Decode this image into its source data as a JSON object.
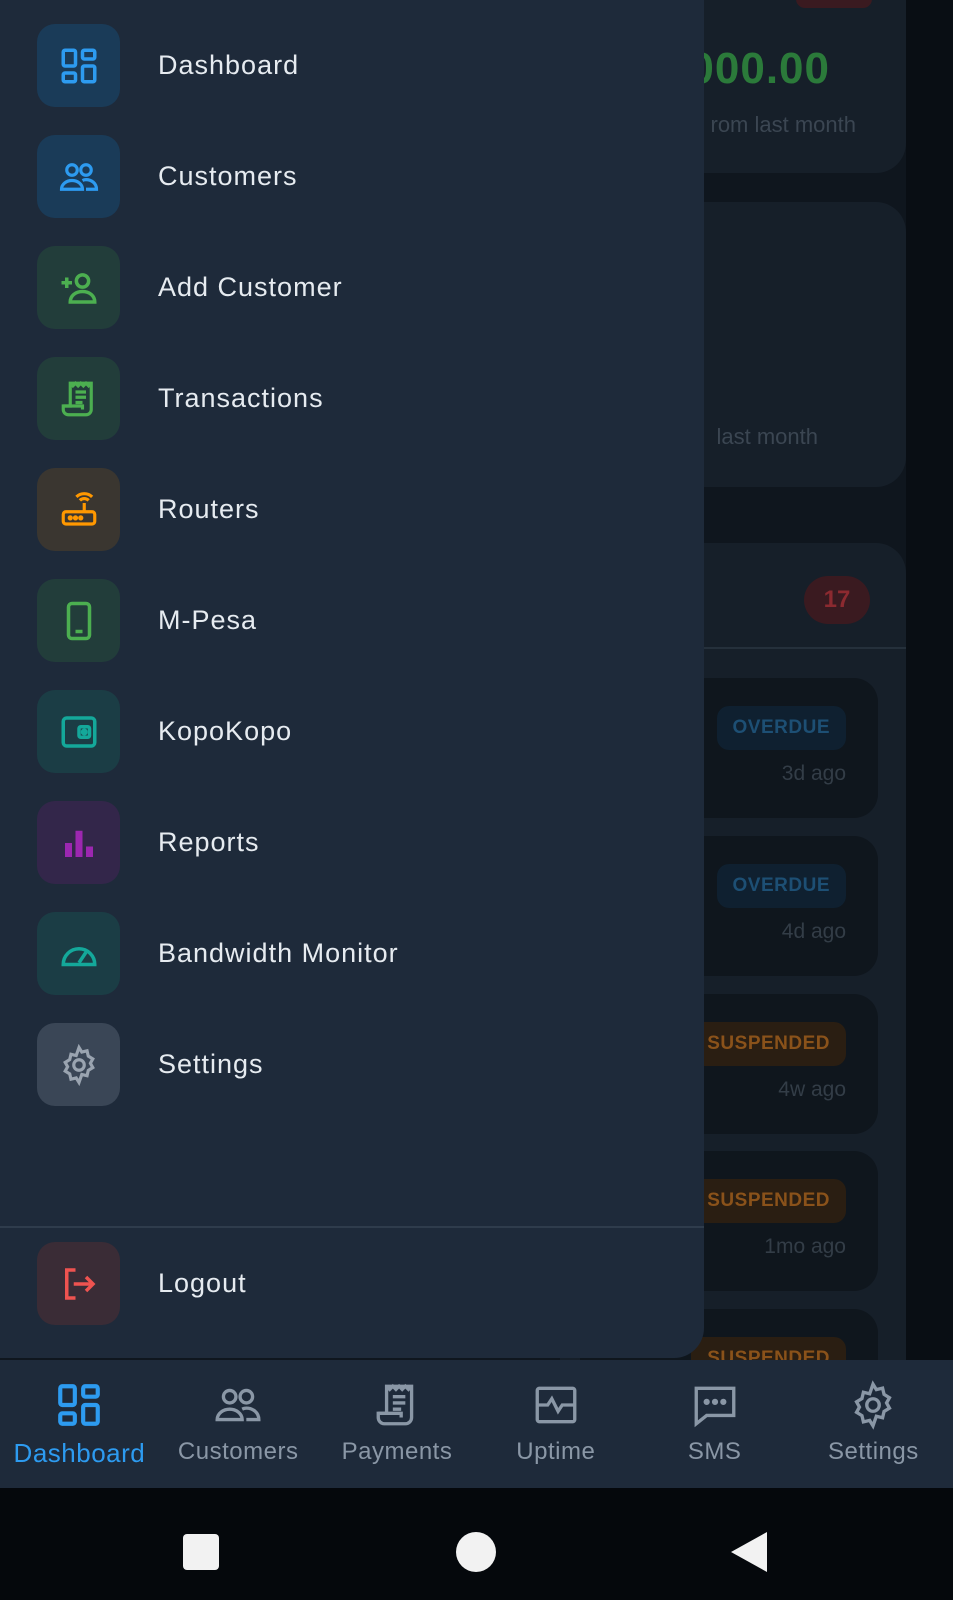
{
  "background": {
    "revenue_amount_fragment": "000.00",
    "revenue_sub_fragment": "rom last month",
    "second_sub_fragment": "last month",
    "list_count": "17",
    "rows": [
      {
        "status": "OVERDUE",
        "ago": "3d ago"
      },
      {
        "status": "OVERDUE",
        "ago": "4d ago"
      },
      {
        "status": "SUSPENDED",
        "ago": "4w ago"
      },
      {
        "status": "SUSPENDED",
        "ago": "1mo ago"
      },
      {
        "status": "SUSPENDED",
        "ago": ""
      }
    ]
  },
  "drawer": {
    "items": [
      {
        "label": "Dashboard",
        "icon": "dashboard-icon",
        "color": "#2d9bf0",
        "bg": "#1a3b58"
      },
      {
        "label": "Customers",
        "icon": "customers-icon",
        "color": "#2d9bf0",
        "bg": "#1a3b58"
      },
      {
        "label": "Add Customer",
        "icon": "add-user-icon",
        "color": "#4caf50",
        "bg": "#223d3a"
      },
      {
        "label": "Transactions",
        "icon": "receipt-icon",
        "color": "#4caf50",
        "bg": "#223d3a"
      },
      {
        "label": "Routers",
        "icon": "router-icon",
        "color": "#ff9800",
        "bg": "#3a3630"
      },
      {
        "label": "M-Pesa",
        "icon": "phone-icon",
        "color": "#4caf50",
        "bg": "#223d3a"
      },
      {
        "label": "KopoKopo",
        "icon": "wallet-icon",
        "color": "#14a89a",
        "bg": "#1b3d45"
      },
      {
        "label": "Reports",
        "icon": "bar-chart-icon",
        "color": "#9c27b0",
        "bg": "#33264a"
      },
      {
        "label": "Bandwidth Monitor",
        "icon": "speedometer-icon",
        "color": "#14a89a",
        "bg": "#1b3d45"
      },
      {
        "label": "Settings",
        "icon": "gear-icon",
        "color": "#9aa4b0",
        "bg": "#3a4656"
      }
    ],
    "logout": {
      "label": "Logout",
      "icon": "logout-icon",
      "color": "#ef5350",
      "bg": "#3a2c36"
    }
  },
  "bottom_nav": {
    "active": "Dashboard",
    "active_color": "#2d9bf0",
    "items": [
      {
        "label": "Dashboard",
        "icon": "dashboard-icon"
      },
      {
        "label": "Customers",
        "icon": "customers-icon"
      },
      {
        "label": "Payments",
        "icon": "receipt-icon"
      },
      {
        "label": "Uptime",
        "icon": "pulse-monitor-icon"
      },
      {
        "label": "SMS",
        "icon": "chat-icon"
      },
      {
        "label": "Settings",
        "icon": "gear-icon"
      }
    ]
  },
  "system_nav": {
    "buttons": [
      "recent-apps",
      "home",
      "back"
    ]
  }
}
